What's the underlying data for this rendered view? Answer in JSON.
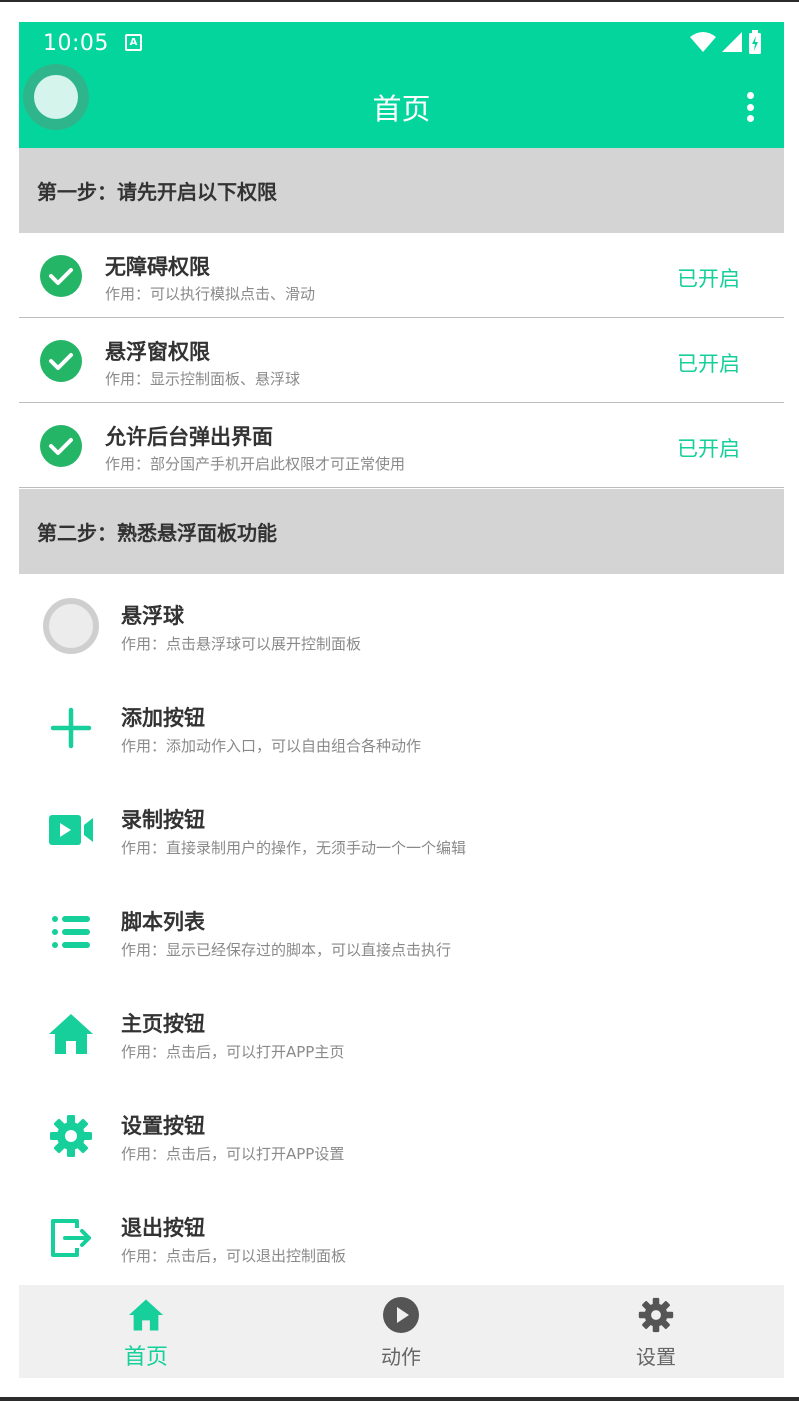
{
  "status_bar": {
    "time": "10:05",
    "notification_badge": "A"
  },
  "app_bar": {
    "title": "首页"
  },
  "section1": {
    "title": "第一步：请先开启以下权限"
  },
  "permissions": [
    {
      "title": "无障碍权限",
      "desc": "作用：可以执行模拟点击、滑动",
      "status": "已开启"
    },
    {
      "title": "悬浮窗权限",
      "desc": "作用：显示控制面板、悬浮球",
      "status": "已开启"
    },
    {
      "title": "允许后台弹出界面",
      "desc": "作用：部分国产手机开启此权限才可正常使用",
      "status": "已开启"
    }
  ],
  "section2": {
    "title": "第二步：熟悉悬浮面板功能"
  },
  "features": [
    {
      "icon": "floating-ball-icon",
      "title": "悬浮球",
      "desc": "作用：点击悬浮球可以展开控制面板"
    },
    {
      "icon": "plus-icon",
      "title": "添加按钮",
      "desc": "作用：添加动作入口，可以自由组合各种动作"
    },
    {
      "icon": "video-record-icon",
      "title": "录制按钮",
      "desc": "作用：直接录制用户的操作，无须手动一个一个编辑"
    },
    {
      "icon": "list-icon",
      "title": "脚本列表",
      "desc": "作用：显示已经保存过的脚本，可以直接点击执行"
    },
    {
      "icon": "home-icon",
      "title": "主页按钮",
      "desc": "作用：点击后，可以打开APP主页"
    },
    {
      "icon": "gear-icon",
      "title": "设置按钮",
      "desc": "作用：点击后，可以打开APP设置"
    },
    {
      "icon": "exit-icon",
      "title": "退出按钮",
      "desc": "作用：点击后，可以退出控制面板"
    }
  ],
  "bottom_nav": [
    {
      "icon": "home-icon",
      "label": "首页",
      "active": true
    },
    {
      "icon": "play-circle-icon",
      "label": "动作",
      "active": false
    },
    {
      "icon": "gear-icon",
      "label": "设置",
      "active": false
    }
  ],
  "colors": {
    "accent": "#03d59d",
    "check": "#25b567",
    "status_text": "#16cf9a",
    "section_bg": "#d4d4d4",
    "nav_bg": "#f0f0f0"
  }
}
